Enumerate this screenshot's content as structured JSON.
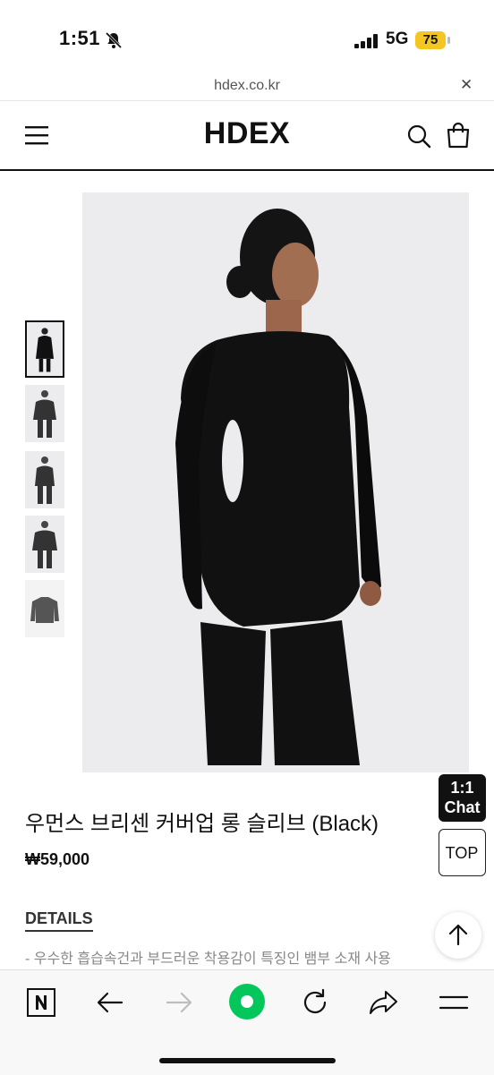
{
  "status_bar": {
    "time": "1:51",
    "network": "5G",
    "battery": "75",
    "icons": [
      "bell-off-icon",
      "signal-icon",
      "battery-icon"
    ],
    "battery_color": "#f3c623"
  },
  "browser": {
    "url": "hdex.co.kr",
    "close_glyph": "✕"
  },
  "header": {
    "logo": "HDEX",
    "icons": [
      "menu-icon",
      "search-icon",
      "shopping-bag-icon"
    ]
  },
  "gallery": {
    "thumbnails": [
      {
        "kind": "back-view",
        "active": true
      },
      {
        "kind": "side-view",
        "active": false
      },
      {
        "kind": "front-view",
        "active": false
      },
      {
        "kind": "front-view-2",
        "active": false
      },
      {
        "kind": "flat-lay",
        "active": false
      }
    ]
  },
  "product": {
    "title": "우먼스 브리센 커버업 롱 슬리브 (Black)",
    "price": "₩59,000"
  },
  "floating": {
    "chat_line1": "1:1",
    "chat_line2": "Chat",
    "top_label": "TOP"
  },
  "details": {
    "heading": "DETAILS",
    "line": "- 우수한 흡습속건과 부드러운 착용감이 특징인 뱀부 소재 사용"
  },
  "toolbar": {
    "icons": [
      "naver-icon",
      "back-arrow-icon",
      "forward-arrow-icon",
      "green-dot-icon",
      "reload-icon",
      "share-icon",
      "hamburger-icon"
    ],
    "accent": "#03c75a"
  }
}
